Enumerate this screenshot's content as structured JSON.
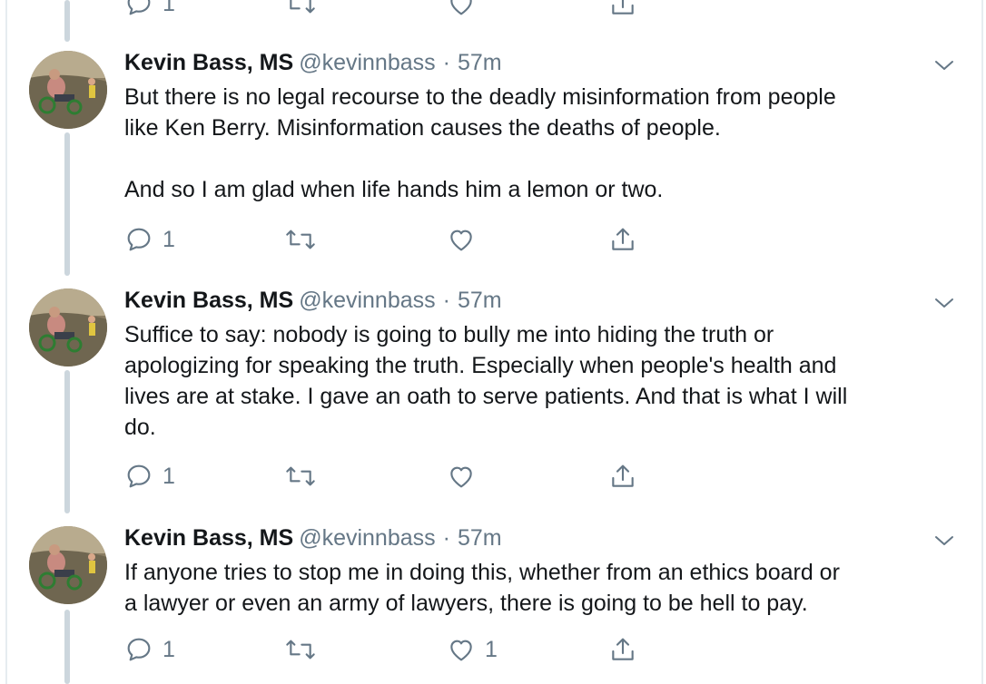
{
  "tweets": [
    {
      "name": "Kevin Bass, MS",
      "handle": "@kevinnbass",
      "separator": "·",
      "time": "57m",
      "text": "But there is no legal recourse to the deadly misinformation from people\nlike Ken Berry. Misinformation causes the deaths of people.\n\nAnd so I am glad when life hands him a lemon or two.",
      "reply_count": "1",
      "retweet_count": "",
      "like_count": ""
    },
    {
      "name": "Kevin Bass, MS",
      "handle": "@kevinnbass",
      "separator": "·",
      "time": "57m",
      "text": "Suffice to say: nobody is going to bully me into hiding the truth or\napologizing for speaking the truth. Especially when people's health and\nlives are at stake. I gave an oath to serve patients. And that is what I will\ndo.",
      "reply_count": "1",
      "retweet_count": "",
      "like_count": ""
    },
    {
      "name": "Kevin Bass, MS",
      "handle": "@kevinnbass",
      "separator": "·",
      "time": "57m",
      "text": "If anyone tries to stop me in doing this, whether from an ethics board or\na lawyer or even an army of lawyers, there is going to be hell to pay.",
      "reply_count": "1",
      "retweet_count": "",
      "like_count": "1"
    }
  ],
  "previous_tweet": {
    "reply_count": "1"
  },
  "icons": {
    "reply": "reply-icon",
    "retweet": "retweet-icon",
    "like": "heart-icon",
    "share": "share-icon",
    "more": "chevron-down-icon"
  },
  "colors": {
    "icon": "#657786",
    "thread_line": "#ccd6dd",
    "text": "#14171a"
  }
}
